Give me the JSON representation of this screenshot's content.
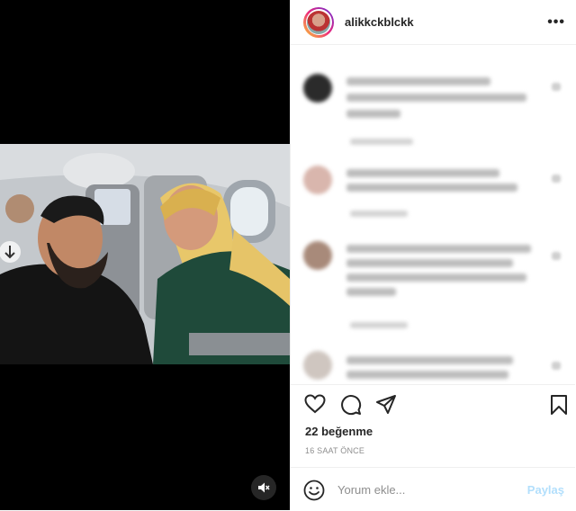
{
  "post": {
    "username": "alikkckblckk",
    "more_icon_label": "•••",
    "likes": "22 beğenme",
    "time_ago": "16 SAAT ÖNCE"
  },
  "comment_box": {
    "placeholder": "Yorum ekle...",
    "post_label": "Paylaş"
  },
  "icons": {
    "like": "heart-icon",
    "comment": "comment-bubble-icon",
    "share": "paper-plane-icon",
    "save": "bookmark-icon",
    "emoji": "smiley-icon",
    "mute": "speaker-muted-icon"
  },
  "colors": {
    "post_button_disabled": "#b2dffc",
    "text": "#262626",
    "secondary": "#8e8e8e"
  }
}
